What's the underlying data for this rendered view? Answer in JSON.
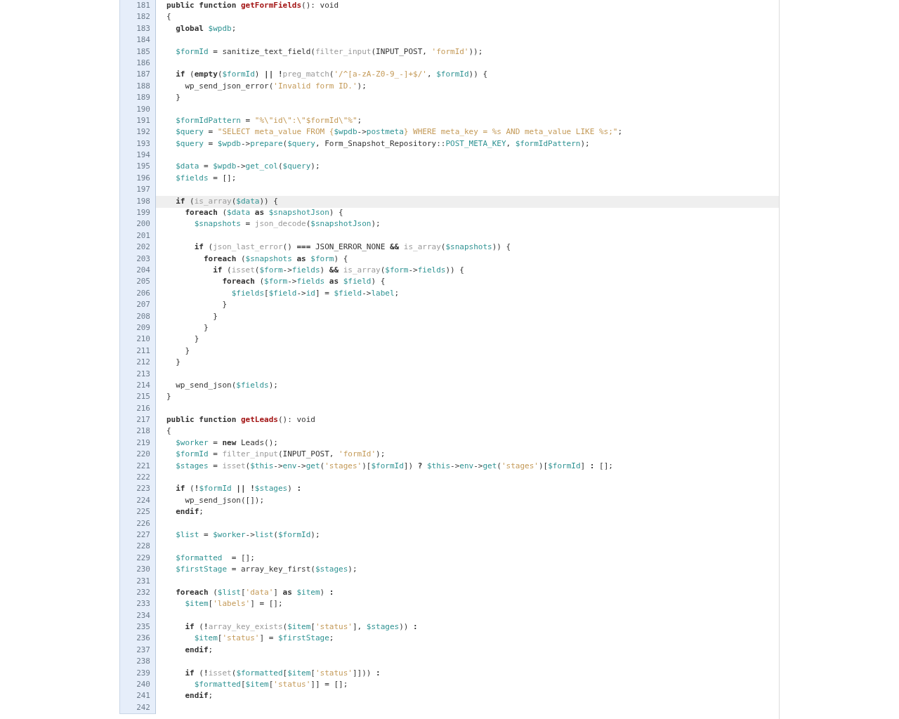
{
  "lines": [
    {
      "number": "181",
      "highlighted": false,
      "tokens": [
        {
          "kind": "k",
          "text": "public function "
        },
        {
          "kind": "f",
          "text": "getFormFields"
        },
        {
          "kind": "p",
          "text": "(): void"
        }
      ]
    },
    {
      "number": "182",
      "highlighted": false,
      "tokens": [
        {
          "kind": "p",
          "text": "{"
        }
      ]
    },
    {
      "number": "183",
      "highlighted": false,
      "tokens": [
        {
          "kind": "k",
          "text": "  global "
        },
        {
          "kind": "v",
          "text": "$wpdb"
        },
        {
          "kind": "p",
          "text": ";"
        }
      ]
    },
    {
      "number": "184",
      "highlighted": false
    },
    {
      "number": "185",
      "highlighted": false,
      "tokens": [
        {
          "kind": "v",
          "text": "  $formId"
        },
        {
          "kind": "p",
          "text": " = sanitize_text_field("
        },
        {
          "kind": "b",
          "text": "filter_input"
        },
        {
          "kind": "p",
          "text": "(INPUT_POST, "
        },
        {
          "kind": "s",
          "text": "'formId'"
        },
        {
          "kind": "p",
          "text": "));"
        }
      ]
    },
    {
      "number": "186",
      "highlighted": false
    },
    {
      "number": "187",
      "highlighted": false,
      "tokens": [
        {
          "kind": "k",
          "text": "  if"
        },
        {
          "kind": "p",
          "text": " ("
        },
        {
          "kind": "k",
          "text": "empty"
        },
        {
          "kind": "p",
          "text": "("
        },
        {
          "kind": "v",
          "text": "$formId"
        },
        {
          "kind": "p",
          "text": ") "
        },
        {
          "kind": "k",
          "text": "|| !"
        },
        {
          "kind": "b",
          "text": "preg_match"
        },
        {
          "kind": "p",
          "text": "("
        },
        {
          "kind": "s",
          "text": "'/^[a-zA-Z0-9_-]+$/'"
        },
        {
          "kind": "p",
          "text": ", "
        },
        {
          "kind": "v",
          "text": "$formId"
        },
        {
          "kind": "p",
          "text": ")) {"
        }
      ]
    },
    {
      "number": "188",
      "highlighted": false,
      "tokens": [
        {
          "kind": "p",
          "text": "    wp_send_json_error("
        },
        {
          "kind": "s",
          "text": "'Invalid form ID.'"
        },
        {
          "kind": "p",
          "text": ");"
        }
      ]
    },
    {
      "number": "189",
      "highlighted": false,
      "tokens": [
        {
          "kind": "p",
          "text": "  }"
        }
      ]
    },
    {
      "number": "190",
      "highlighted": false
    },
    {
      "number": "191",
      "highlighted": false,
      "tokens": [
        {
          "kind": "v",
          "text": "  $formIdPattern"
        },
        {
          "kind": "p",
          "text": " = "
        },
        {
          "kind": "s",
          "text": "\"%\\\"id\\\":\\\"$formId\\\"%\""
        },
        {
          "kind": "p",
          "text": ";"
        }
      ]
    },
    {
      "number": "192",
      "highlighted": false,
      "tokens": [
        {
          "kind": "v",
          "text": "  $query"
        },
        {
          "kind": "p",
          "text": " = "
        },
        {
          "kind": "s",
          "text": "\"SELECT meta_value FROM {"
        },
        {
          "kind": "v",
          "text": "$wpdb"
        },
        {
          "kind": "p",
          "text": "->"
        },
        {
          "kind": "v",
          "text": "postmeta"
        },
        {
          "kind": "s",
          "text": "} WHERE meta_key = %s AND meta_value LIKE %s;\""
        },
        {
          "kind": "p",
          "text": ";"
        }
      ]
    },
    {
      "number": "193",
      "highlighted": false,
      "tokens": [
        {
          "kind": "v",
          "text": "  $query"
        },
        {
          "kind": "p",
          "text": " = "
        },
        {
          "kind": "v",
          "text": "$wpdb"
        },
        {
          "kind": "p",
          "text": "->"
        },
        {
          "kind": "v",
          "text": "prepare"
        },
        {
          "kind": "p",
          "text": "("
        },
        {
          "kind": "v",
          "text": "$query"
        },
        {
          "kind": "p",
          "text": ", Form_Snapshot_Repository::"
        },
        {
          "kind": "v",
          "text": "POST_META_KEY"
        },
        {
          "kind": "p",
          "text": ", "
        },
        {
          "kind": "v",
          "text": "$formIdPattern"
        },
        {
          "kind": "p",
          "text": ");"
        }
      ]
    },
    {
      "number": "194",
      "highlighted": false
    },
    {
      "number": "195",
      "highlighted": false,
      "tokens": [
        {
          "kind": "v",
          "text": "  $data"
        },
        {
          "kind": "p",
          "text": " = "
        },
        {
          "kind": "v",
          "text": "$wpdb"
        },
        {
          "kind": "p",
          "text": "->"
        },
        {
          "kind": "v",
          "text": "get_col"
        },
        {
          "kind": "p",
          "text": "("
        },
        {
          "kind": "v",
          "text": "$query"
        },
        {
          "kind": "p",
          "text": ");"
        }
      ]
    },
    {
      "number": "196",
      "highlighted": false,
      "tokens": [
        {
          "kind": "v",
          "text": "  $fields"
        },
        {
          "kind": "p",
          "text": " = [];"
        }
      ]
    },
    {
      "number": "197",
      "highlighted": false
    },
    {
      "number": "198",
      "highlighted": true,
      "tokens": [
        {
          "kind": "k",
          "text": "  if"
        },
        {
          "kind": "p",
          "text": " ("
        },
        {
          "kind": "b",
          "text": "is_array"
        },
        {
          "kind": "p",
          "text": "("
        },
        {
          "kind": "v",
          "text": "$data"
        },
        {
          "kind": "p",
          "text": ")) {"
        }
      ]
    },
    {
      "number": "199",
      "highlighted": false,
      "tokens": [
        {
          "kind": "k",
          "text": "    foreach"
        },
        {
          "kind": "p",
          "text": " ("
        },
        {
          "kind": "v",
          "text": "$data"
        },
        {
          "kind": "k",
          "text": " as "
        },
        {
          "kind": "v",
          "text": "$snapshotJson"
        },
        {
          "kind": "p",
          "text": ") {"
        }
      ]
    },
    {
      "number": "200",
      "highlighted": false,
      "tokens": [
        {
          "kind": "v",
          "text": "      $snapshots"
        },
        {
          "kind": "p",
          "text": " = "
        },
        {
          "kind": "b",
          "text": "json_decode"
        },
        {
          "kind": "p",
          "text": "("
        },
        {
          "kind": "v",
          "text": "$snapshotJson"
        },
        {
          "kind": "p",
          "text": ");"
        }
      ]
    },
    {
      "number": "201",
      "highlighted": false
    },
    {
      "number": "202",
      "highlighted": false,
      "tokens": [
        {
          "kind": "k",
          "text": "      if"
        },
        {
          "kind": "p",
          "text": " ("
        },
        {
          "kind": "b",
          "text": "json_last_error"
        },
        {
          "kind": "p",
          "text": "() "
        },
        {
          "kind": "k",
          "text": "==="
        },
        {
          "kind": "p",
          "text": " JSON_ERROR_NONE "
        },
        {
          "kind": "k",
          "text": "&& "
        },
        {
          "kind": "b",
          "text": "is_array"
        },
        {
          "kind": "p",
          "text": "("
        },
        {
          "kind": "v",
          "text": "$snapshots"
        },
        {
          "kind": "p",
          "text": ")) {"
        }
      ]
    },
    {
      "number": "203",
      "highlighted": false,
      "tokens": [
        {
          "kind": "k",
          "text": "        foreach"
        },
        {
          "kind": "p",
          "text": " ("
        },
        {
          "kind": "v",
          "text": "$snapshots"
        },
        {
          "kind": "k",
          "text": " as "
        },
        {
          "kind": "v",
          "text": "$form"
        },
        {
          "kind": "p",
          "text": ") {"
        }
      ]
    },
    {
      "number": "204",
      "highlighted": false,
      "tokens": [
        {
          "kind": "k",
          "text": "          if"
        },
        {
          "kind": "p",
          "text": " ("
        },
        {
          "kind": "b",
          "text": "isset"
        },
        {
          "kind": "p",
          "text": "("
        },
        {
          "kind": "v",
          "text": "$form"
        },
        {
          "kind": "p",
          "text": "->"
        },
        {
          "kind": "v",
          "text": "fields"
        },
        {
          "kind": "p",
          "text": ") "
        },
        {
          "kind": "k",
          "text": "&& "
        },
        {
          "kind": "b",
          "text": "is_array"
        },
        {
          "kind": "p",
          "text": "("
        },
        {
          "kind": "v",
          "text": "$form"
        },
        {
          "kind": "p",
          "text": "->"
        },
        {
          "kind": "v",
          "text": "fields"
        },
        {
          "kind": "p",
          "text": ")) {"
        }
      ]
    },
    {
      "number": "205",
      "highlighted": false,
      "tokens": [
        {
          "kind": "k",
          "text": "            foreach"
        },
        {
          "kind": "p",
          "text": " ("
        },
        {
          "kind": "v",
          "text": "$form"
        },
        {
          "kind": "p",
          "text": "->"
        },
        {
          "kind": "v",
          "text": "fields"
        },
        {
          "kind": "k",
          "text": " as "
        },
        {
          "kind": "v",
          "text": "$field"
        },
        {
          "kind": "p",
          "text": ") {"
        }
      ]
    },
    {
      "number": "206",
      "highlighted": false,
      "tokens": [
        {
          "kind": "v",
          "text": "              $fields"
        },
        {
          "kind": "p",
          "text": "["
        },
        {
          "kind": "v",
          "text": "$field"
        },
        {
          "kind": "p",
          "text": "->"
        },
        {
          "kind": "v",
          "text": "id"
        },
        {
          "kind": "p",
          "text": "] = "
        },
        {
          "kind": "v",
          "text": "$field"
        },
        {
          "kind": "p",
          "text": "->"
        },
        {
          "kind": "v",
          "text": "label"
        },
        {
          "kind": "p",
          "text": ";"
        }
      ]
    },
    {
      "number": "207",
      "highlighted": false,
      "tokens": [
        {
          "kind": "p",
          "text": "            }"
        }
      ]
    },
    {
      "number": "208",
      "highlighted": false,
      "tokens": [
        {
          "kind": "p",
          "text": "          }"
        }
      ]
    },
    {
      "number": "209",
      "highlighted": false,
      "tokens": [
        {
          "kind": "p",
          "text": "        }"
        }
      ]
    },
    {
      "number": "210",
      "highlighted": false,
      "tokens": [
        {
          "kind": "p",
          "text": "      }"
        }
      ]
    },
    {
      "number": "211",
      "highlighted": false,
      "tokens": [
        {
          "kind": "p",
          "text": "    }"
        }
      ]
    },
    {
      "number": "212",
      "highlighted": false,
      "tokens": [
        {
          "kind": "p",
          "text": "  }"
        }
      ]
    },
    {
      "number": "213",
      "highlighted": false
    },
    {
      "number": "214",
      "highlighted": false,
      "tokens": [
        {
          "kind": "p",
          "text": "  wp_send_json("
        },
        {
          "kind": "v",
          "text": "$fields"
        },
        {
          "kind": "p",
          "text": ");"
        }
      ]
    },
    {
      "number": "215",
      "highlighted": false,
      "tokens": [
        {
          "kind": "p",
          "text": "}"
        }
      ]
    },
    {
      "number": "216",
      "highlighted": false
    },
    {
      "number": "217",
      "highlighted": false,
      "tokens": [
        {
          "kind": "k",
          "text": "public function "
        },
        {
          "kind": "f",
          "text": "getLeads"
        },
        {
          "kind": "p",
          "text": "(): void"
        }
      ]
    },
    {
      "number": "218",
      "highlighted": false,
      "tokens": [
        {
          "kind": "p",
          "text": "{"
        }
      ]
    },
    {
      "number": "219",
      "highlighted": false,
      "tokens": [
        {
          "kind": "v",
          "text": "  $worker"
        },
        {
          "kind": "p",
          "text": " = "
        },
        {
          "kind": "k",
          "text": "new"
        },
        {
          "kind": "p",
          "text": " Leads();"
        }
      ]
    },
    {
      "number": "220",
      "highlighted": false,
      "tokens": [
        {
          "kind": "v",
          "text": "  $formId"
        },
        {
          "kind": "p",
          "text": " = "
        },
        {
          "kind": "b",
          "text": "filter_input"
        },
        {
          "kind": "p",
          "text": "(INPUT_POST, "
        },
        {
          "kind": "s",
          "text": "'formId'"
        },
        {
          "kind": "p",
          "text": ");"
        }
      ]
    },
    {
      "number": "221",
      "highlighted": false,
      "tokens": [
        {
          "kind": "v",
          "text": "  $stages"
        },
        {
          "kind": "p",
          "text": " = "
        },
        {
          "kind": "b",
          "text": "isset"
        },
        {
          "kind": "p",
          "text": "("
        },
        {
          "kind": "v",
          "text": "$this"
        },
        {
          "kind": "p",
          "text": "->"
        },
        {
          "kind": "v",
          "text": "env"
        },
        {
          "kind": "p",
          "text": "->"
        },
        {
          "kind": "v",
          "text": "get"
        },
        {
          "kind": "p",
          "text": "("
        },
        {
          "kind": "s",
          "text": "'stages'"
        },
        {
          "kind": "p",
          "text": ")["
        },
        {
          "kind": "v",
          "text": "$formId"
        },
        {
          "kind": "p",
          "text": "]) "
        },
        {
          "kind": "k",
          "text": "? "
        },
        {
          "kind": "v",
          "text": "$this"
        },
        {
          "kind": "p",
          "text": "->"
        },
        {
          "kind": "v",
          "text": "env"
        },
        {
          "kind": "p",
          "text": "->"
        },
        {
          "kind": "v",
          "text": "get"
        },
        {
          "kind": "p",
          "text": "("
        },
        {
          "kind": "s",
          "text": "'stages'"
        },
        {
          "kind": "p",
          "text": ")["
        },
        {
          "kind": "v",
          "text": "$formId"
        },
        {
          "kind": "p",
          "text": "] "
        },
        {
          "kind": "k",
          "text": ":"
        },
        {
          "kind": "p",
          "text": " [];"
        }
      ]
    },
    {
      "number": "222",
      "highlighted": false
    },
    {
      "number": "223",
      "highlighted": false,
      "tokens": [
        {
          "kind": "k",
          "text": "  if"
        },
        {
          "kind": "p",
          "text": " ("
        },
        {
          "kind": "k",
          "text": "!"
        },
        {
          "kind": "v",
          "text": "$formId"
        },
        {
          "kind": "k",
          "text": " || !"
        },
        {
          "kind": "v",
          "text": "$stages"
        },
        {
          "kind": "p",
          "text": ") "
        },
        {
          "kind": "k",
          "text": ":"
        }
      ]
    },
    {
      "number": "224",
      "highlighted": false,
      "tokens": [
        {
          "kind": "p",
          "text": "    wp_send_json([]);"
        }
      ]
    },
    {
      "number": "225",
      "highlighted": false,
      "tokens": [
        {
          "kind": "k",
          "text": "  endif"
        },
        {
          "kind": "p",
          "text": ";"
        }
      ]
    },
    {
      "number": "226",
      "highlighted": false
    },
    {
      "number": "227",
      "highlighted": false,
      "tokens": [
        {
          "kind": "v",
          "text": "  $list"
        },
        {
          "kind": "p",
          "text": " = "
        },
        {
          "kind": "v",
          "text": "$worker"
        },
        {
          "kind": "p",
          "text": "->"
        },
        {
          "kind": "v",
          "text": "list"
        },
        {
          "kind": "p",
          "text": "("
        },
        {
          "kind": "v",
          "text": "$formId"
        },
        {
          "kind": "p",
          "text": ");"
        }
      ]
    },
    {
      "number": "228",
      "highlighted": false
    },
    {
      "number": "229",
      "highlighted": false,
      "tokens": [
        {
          "kind": "v",
          "text": "  $formatted"
        },
        {
          "kind": "p",
          "text": "  = [];"
        }
      ]
    },
    {
      "number": "230",
      "highlighted": false,
      "tokens": [
        {
          "kind": "v",
          "text": "  $firstStage"
        },
        {
          "kind": "p",
          "text": " = array_key_first("
        },
        {
          "kind": "v",
          "text": "$stages"
        },
        {
          "kind": "p",
          "text": ");"
        }
      ]
    },
    {
      "number": "231",
      "highlighted": false
    },
    {
      "number": "232",
      "highlighted": false,
      "tokens": [
        {
          "kind": "k",
          "text": "  foreach"
        },
        {
          "kind": "p",
          "text": " ("
        },
        {
          "kind": "v",
          "text": "$list"
        },
        {
          "kind": "p",
          "text": "["
        },
        {
          "kind": "s",
          "text": "'data'"
        },
        {
          "kind": "p",
          "text": "]"
        },
        {
          "kind": "k",
          "text": " as "
        },
        {
          "kind": "v",
          "text": "$item"
        },
        {
          "kind": "p",
          "text": ") "
        },
        {
          "kind": "k",
          "text": ":"
        }
      ]
    },
    {
      "number": "233",
      "highlighted": false,
      "tokens": [
        {
          "kind": "v",
          "text": "    $item"
        },
        {
          "kind": "p",
          "text": "["
        },
        {
          "kind": "s",
          "text": "'labels'"
        },
        {
          "kind": "p",
          "text": "] = [];"
        }
      ]
    },
    {
      "number": "234",
      "highlighted": false
    },
    {
      "number": "235",
      "highlighted": false,
      "tokens": [
        {
          "kind": "k",
          "text": "    if"
        },
        {
          "kind": "p",
          "text": " ("
        },
        {
          "kind": "k",
          "text": "!"
        },
        {
          "kind": "b",
          "text": "array_key_exists"
        },
        {
          "kind": "p",
          "text": "("
        },
        {
          "kind": "v",
          "text": "$item"
        },
        {
          "kind": "p",
          "text": "["
        },
        {
          "kind": "s",
          "text": "'status'"
        },
        {
          "kind": "p",
          "text": "], "
        },
        {
          "kind": "v",
          "text": "$stages"
        },
        {
          "kind": "p",
          "text": ")) "
        },
        {
          "kind": "k",
          "text": ":"
        }
      ]
    },
    {
      "number": "236",
      "highlighted": false,
      "tokens": [
        {
          "kind": "v",
          "text": "      $item"
        },
        {
          "kind": "p",
          "text": "["
        },
        {
          "kind": "s",
          "text": "'status'"
        },
        {
          "kind": "p",
          "text": "] = "
        },
        {
          "kind": "v",
          "text": "$firstStage"
        },
        {
          "kind": "p",
          "text": ";"
        }
      ]
    },
    {
      "number": "237",
      "highlighted": false,
      "tokens": [
        {
          "kind": "k",
          "text": "    endif"
        },
        {
          "kind": "p",
          "text": ";"
        }
      ]
    },
    {
      "number": "238",
      "highlighted": false
    },
    {
      "number": "239",
      "highlighted": false,
      "tokens": [
        {
          "kind": "k",
          "text": "    if"
        },
        {
          "kind": "p",
          "text": " ("
        },
        {
          "kind": "k",
          "text": "!"
        },
        {
          "kind": "b",
          "text": "isset"
        },
        {
          "kind": "p",
          "text": "("
        },
        {
          "kind": "v",
          "text": "$formatted"
        },
        {
          "kind": "p",
          "text": "["
        },
        {
          "kind": "v",
          "text": "$item"
        },
        {
          "kind": "p",
          "text": "["
        },
        {
          "kind": "s",
          "text": "'status'"
        },
        {
          "kind": "p",
          "text": "]])) "
        },
        {
          "kind": "k",
          "text": ":"
        }
      ]
    },
    {
      "number": "240",
      "highlighted": false,
      "tokens": [
        {
          "kind": "v",
          "text": "      $formatted"
        },
        {
          "kind": "p",
          "text": "["
        },
        {
          "kind": "v",
          "text": "$item"
        },
        {
          "kind": "p",
          "text": "["
        },
        {
          "kind": "s",
          "text": "'status'"
        },
        {
          "kind": "p",
          "text": "]] = [];"
        }
      ]
    },
    {
      "number": "241",
      "highlighted": false,
      "tokens": [
        {
          "kind": "k",
          "text": "    endif"
        },
        {
          "kind": "p",
          "text": ";"
        }
      ]
    },
    {
      "number": "242",
      "highlighted": false
    }
  ]
}
